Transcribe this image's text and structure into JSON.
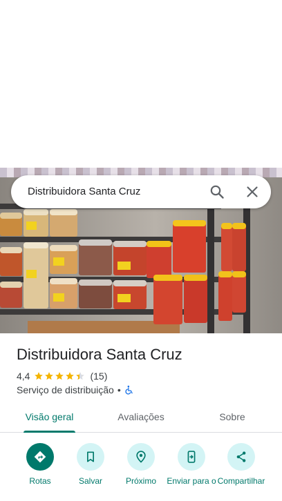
{
  "search": {
    "query": "Distribuidora Santa Cruz"
  },
  "place": {
    "name": "Distribuidora Santa Cruz",
    "rating": "4,4",
    "rating_stars": 4.4,
    "review_count": "(15)",
    "category": "Serviço de distribuição",
    "separator": "•"
  },
  "tabs": [
    {
      "label": "Visão geral",
      "active": true
    },
    {
      "label": "Avaliações",
      "active": false
    },
    {
      "label": "Sobre",
      "active": false
    }
  ],
  "actions": [
    {
      "label": "Rotas",
      "icon": "directions-icon"
    },
    {
      "label": "Salvar",
      "icon": "bookmark-icon"
    },
    {
      "label": "Próximo",
      "icon": "nearby-icon"
    },
    {
      "label": "Enviar para o",
      "icon": "send-to-phone-icon"
    },
    {
      "label": "Compartilhar",
      "icon": "share-icon"
    }
  ],
  "colors": {
    "accent": "#00796b",
    "action_bg": "#d3f4f5",
    "star": "#f4b400",
    "accessible": "#1a73e8"
  }
}
